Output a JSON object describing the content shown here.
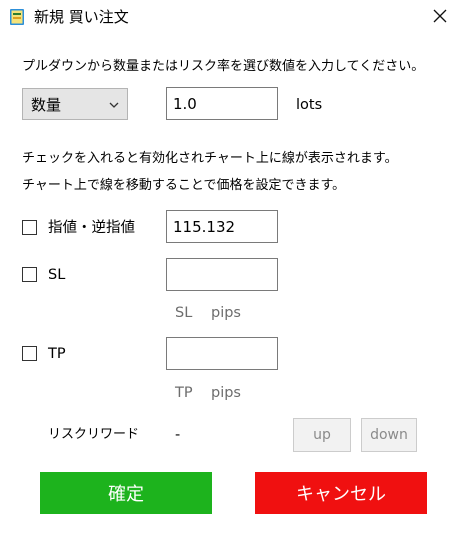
{
  "window": {
    "title": "新規 買い注文",
    "app_icon": "app-icon",
    "close_icon": "close-icon"
  },
  "instruction": "プルダウンから数量またはリスク率を選び数値を入力してください。",
  "quantity": {
    "select_value": "数量",
    "input_value": "1.0",
    "unit": "lots"
  },
  "note": {
    "line1": "チェックを入れると有効化されチャート上に線が表示されます。",
    "line2": "チャート上で線を移動することで価格を設定できます。"
  },
  "price": {
    "label": "指値・逆指値",
    "value": "115.132",
    "checked": false
  },
  "sl": {
    "label": "SL",
    "value": "",
    "pips_prefix": "SL",
    "pips_unit": "pips",
    "checked": false
  },
  "tp": {
    "label": "TP",
    "value": "",
    "pips_prefix": "TP",
    "pips_unit": "pips",
    "checked": false
  },
  "risk_reward": {
    "label": "リスクリワード",
    "value": "-"
  },
  "buttons": {
    "up": "up",
    "down": "down",
    "confirm": "確定",
    "cancel": "キャンセル"
  },
  "colors": {
    "confirm": "#1db31d",
    "cancel": "#f01010"
  }
}
